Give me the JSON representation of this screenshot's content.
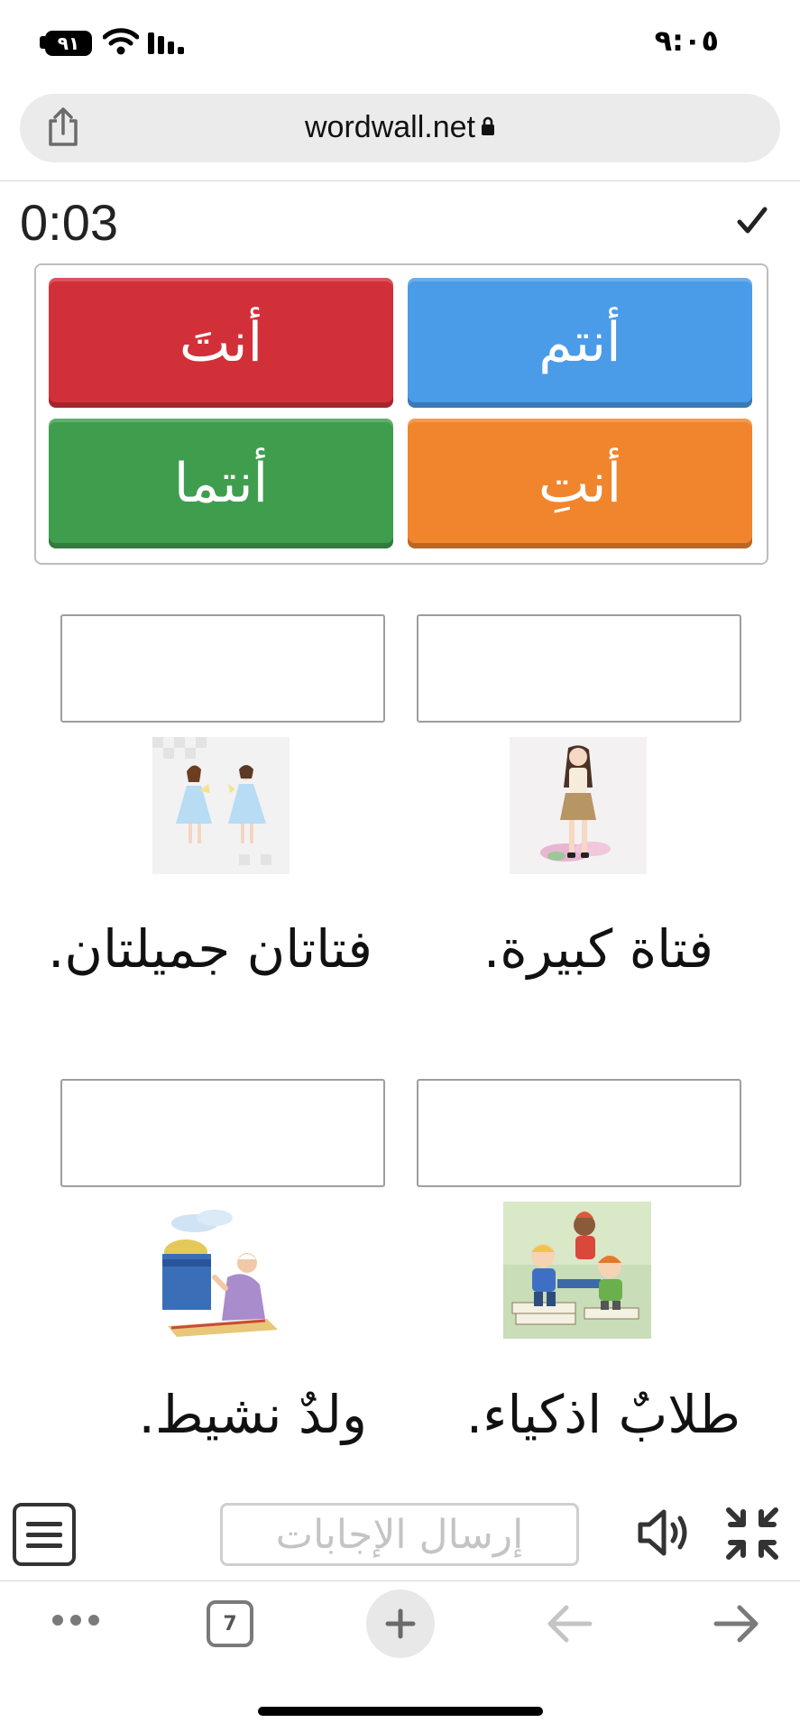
{
  "status_bar": {
    "battery_level": "٩١",
    "time": "٩:٠٥"
  },
  "browser": {
    "url": "wordwall.net",
    "tab_count": "7",
    "icons": [
      "share-icon",
      "lock-icon",
      "more-icon",
      "tabs-icon",
      "plus-icon",
      "back-arrow-icon",
      "forward-arrow-icon"
    ]
  },
  "game": {
    "timer": "0:03",
    "tiles": [
      {
        "label": "أنتَ",
        "color": "#d23039"
      },
      {
        "label": "أنتم",
        "color": "#4a9be8"
      },
      {
        "label": "أنتما",
        "color": "#3f9e4e"
      },
      {
        "label": "أنتِ",
        "color": "#f0852d"
      }
    ],
    "items": [
      {
        "sentence": "فتاة كبيرة.",
        "image": "girl-standing-illustration"
      },
      {
        "sentence": "فتاتان جميلتان.",
        "image": "two-girls-illustration"
      },
      {
        "sentence": "طلابٌ اذكياء.",
        "image": "students-on-books-illustration"
      },
      {
        "sentence": "ولدٌ نشيط.",
        "image": "boy-praying-illustration"
      }
    ],
    "submit_label": "إرسال الإجابات"
  }
}
